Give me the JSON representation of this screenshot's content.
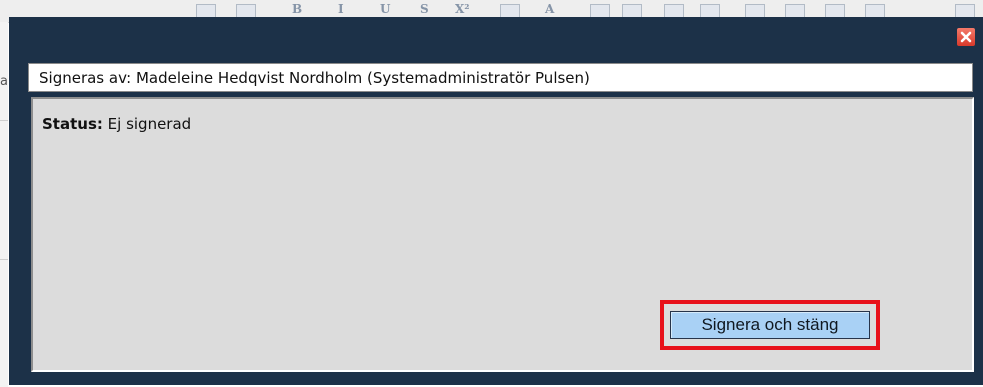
{
  "dialog": {
    "signed_by_text": "Signeras av: Madeleine Hedqvist Nordholm (Systemadministratör Pulsen)",
    "status_label": "Status:",
    "status_value": "Ej signerad",
    "sign_button_label": "Signera och stäng",
    "close_icon": "close-icon"
  },
  "background": {
    "left_fragment": "a",
    "toolbar_glyphs": [
      "B",
      "I",
      "U",
      "S",
      "X²",
      "A"
    ]
  },
  "colors": {
    "dialog_bg": "#1c3148",
    "content_bg": "#dcdcdc",
    "button_bg": "#a9d1f5",
    "highlight": "#e8111a",
    "close_button": "#d8392a"
  }
}
